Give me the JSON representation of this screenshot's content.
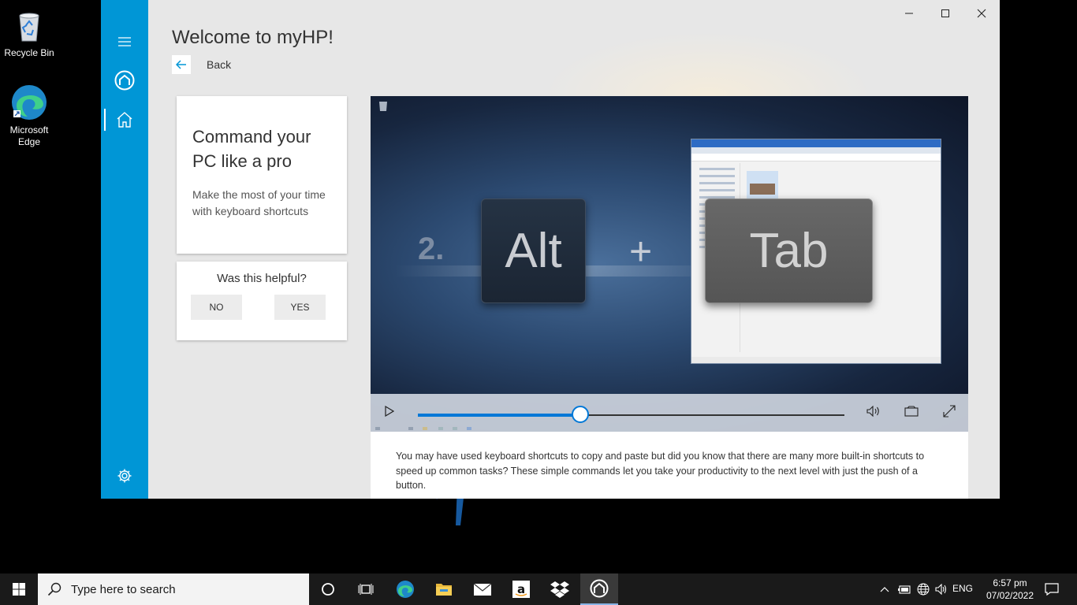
{
  "desktop": {
    "icons": [
      {
        "label": "Recycle Bin",
        "icon": "recycle-bin-icon"
      },
      {
        "label": "Microsoft Edge",
        "icon": "edge-icon"
      }
    ]
  },
  "window": {
    "title": "Welcome to myHP!",
    "back_label": "Back",
    "controls": [
      "minimize-icon",
      "maximize-icon",
      "close-icon"
    ]
  },
  "sidebar": {
    "items": [
      "hamburger-menu-icon",
      "hp-support-icon",
      "home-icon",
      "settings-icon"
    ],
    "active": "home"
  },
  "card": {
    "title": "Command your PC like a pro",
    "subtitle": "Make the most of your time with keyboard shortcuts"
  },
  "helpful": {
    "question": "Was this helpful?",
    "no_label": "NO",
    "yes_label": "YES"
  },
  "video": {
    "step": "2.",
    "key1": "Alt",
    "plus": "+",
    "key2": "Tab",
    "progress": 0.38,
    "controls": [
      "play-icon",
      "volume-icon",
      "cast-icon",
      "fullscreen-icon"
    ]
  },
  "description": "You may have used keyboard shortcuts to copy and paste but did you know that there are many more built-in shortcuts to speed up common tasks? These simple commands let you take your productivity to the next level with just the push of a button.",
  "taskbar": {
    "search_placeholder": "Type here to search",
    "apps": [
      "cortana-icon",
      "task-view-icon",
      "edge-icon",
      "file-explorer-icon",
      "mail-icon",
      "amazon-icon",
      "dropbox-icon",
      "myhp-icon"
    ],
    "active_app": "myhp-icon",
    "language": "ENG",
    "time": "6:57 pm",
    "date": "07/02/2022"
  },
  "colors": {
    "sidebar": "#0096d6",
    "accent": "#0078d7",
    "taskbar": "#1a1a1a"
  }
}
